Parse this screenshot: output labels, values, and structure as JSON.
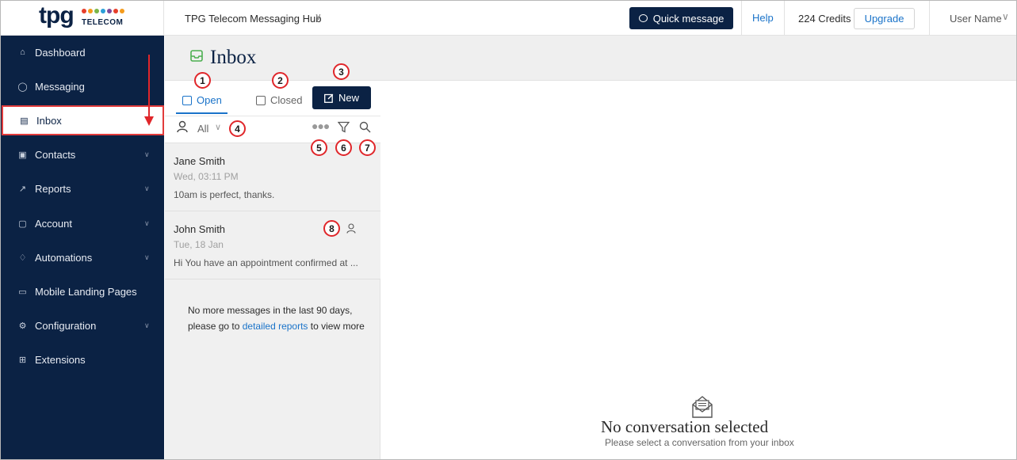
{
  "header": {
    "logo_text": "tpg",
    "logo_subtext": "TELECOM",
    "logo_dots": [
      "#e63e2b",
      "#f49b1c",
      "#7ab648",
      "#2b9fd8",
      "#7c4a9c",
      "#e63e2b",
      "#f49b1c"
    ],
    "hub_title": "TPG Telecom Messaging Hub",
    "quick_message": "Quick message",
    "help": "Help",
    "credits": "224 Credits",
    "upgrade": "Upgrade",
    "user_name": "User Name"
  },
  "sidebar": {
    "items": [
      {
        "label": "Dashboard",
        "icon": "home-icon",
        "has_chevron": false
      },
      {
        "label": "Messaging",
        "icon": "circle-icon",
        "has_chevron": false
      },
      {
        "label": "Inbox",
        "icon": "inbox-icon",
        "has_chevron": false,
        "active": true
      },
      {
        "label": "Contacts",
        "icon": "contacts-icon",
        "has_chevron": true
      },
      {
        "label": "Reports",
        "icon": "chart-icon",
        "has_chevron": true
      },
      {
        "label": "Account",
        "icon": "account-icon",
        "has_chevron": true
      },
      {
        "label": "Automations",
        "icon": "automations-icon",
        "has_chevron": true
      },
      {
        "label": "Mobile Landing Pages",
        "icon": "landing-page-icon",
        "has_chevron": false
      },
      {
        "label": "Configuration",
        "icon": "gear-icon",
        "has_chevron": true
      },
      {
        "label": "Extensions",
        "icon": "extensions-icon",
        "has_chevron": false
      }
    ]
  },
  "page": {
    "title": "Inbox"
  },
  "tabs": {
    "open": "Open",
    "closed": "Closed",
    "new": "New"
  },
  "filter": {
    "assignee": "All"
  },
  "conversations": [
    {
      "name": "Jane Smith",
      "date": "Wed, 03:11 PM",
      "snippet": "10am is perfect, thanks."
    },
    {
      "name": "John Smith",
      "date": "Tue, 18 Jan",
      "snippet": "Hi You have an appointment confirmed at ..."
    }
  ],
  "list_footer": {
    "text_before": "No more messages in the last 90 days, please go to ",
    "link": "detailed reports",
    "text_after": " to view more"
  },
  "detail": {
    "empty_title": "No conversation selected",
    "empty_subtitle": "Please select a conversation from your inbox"
  },
  "markers": [
    "1",
    "2",
    "3",
    "4",
    "5",
    "6",
    "7",
    "8"
  ],
  "colors": {
    "navy": "#0b2244",
    "accent_blue": "#1a73c9",
    "annotation_red": "#e0262a",
    "inbox_icon_green": "#4caf50"
  }
}
